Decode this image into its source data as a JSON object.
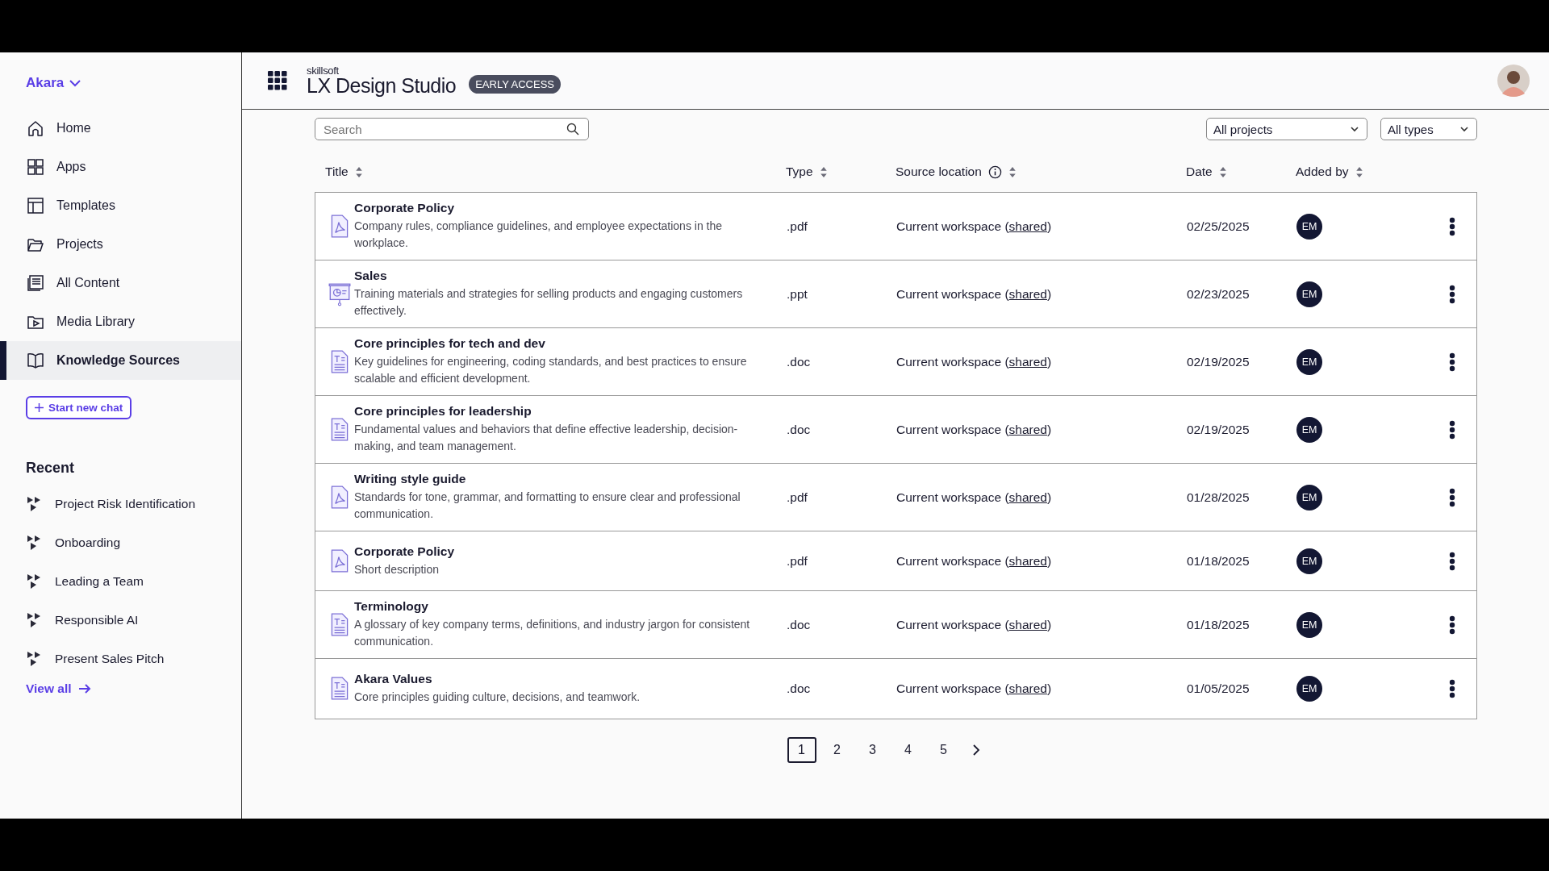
{
  "sidebar": {
    "workspace": "Akara",
    "nav": [
      {
        "label": "Home",
        "selected": false
      },
      {
        "label": "Apps",
        "selected": false
      },
      {
        "label": "Templates",
        "selected": false
      },
      {
        "label": "Projects",
        "selected": false
      },
      {
        "label": "All Content",
        "selected": false
      },
      {
        "label": "Media Library",
        "selected": false
      },
      {
        "label": "Knowledge Sources",
        "selected": true
      }
    ],
    "start_chat": "Start new chat",
    "recent": {
      "title": "Recent",
      "items": [
        "Project Risk Identification",
        "Onboarding",
        "Leading a Team",
        "Responsible AI",
        "Present Sales Pitch"
      ],
      "view_all": "View all"
    }
  },
  "header": {
    "brand": "skillsoft",
    "product": "LX Design Studio",
    "badge": "EARLY ACCESS"
  },
  "filters": {
    "search": {
      "placeholder": "Search"
    },
    "dropdowns": [
      "All projects",
      "All types"
    ]
  },
  "table": {
    "columns": [
      {
        "label": "Title",
        "info": false
      },
      {
        "label": "Type",
        "info": false
      },
      {
        "label": "Source location",
        "info": true
      },
      {
        "label": "Date",
        "info": false
      },
      {
        "label": "Added by",
        "info": false
      }
    ],
    "rows": [
      {
        "kind": "pdf",
        "title": "Corporate Policy",
        "description": "Company rules, compliance guidelines, and employee expectations in the workplace.",
        "type": ".pdf",
        "source": "Current workspace (",
        "source_link": "shared",
        "source_end": ")",
        "date": "02/25/2025",
        "added_by": "EM"
      },
      {
        "kind": "ppt",
        "title": "Sales",
        "description": "Training materials and strategies for selling products and engaging customers effectively.",
        "type": ".ppt",
        "source": "Current workspace (",
        "source_link": "shared",
        "source_end": ")",
        "date": "02/23/2025",
        "added_by": "EM"
      },
      {
        "kind": "doc",
        "title": "Core principles for tech and dev",
        "description": "Key guidelines for engineering, coding standards, and best practices to ensure scalable and efficient development.",
        "type": ".doc",
        "source": "Current workspace (",
        "source_link": "shared",
        "source_end": ")",
        "date": "02/19/2025",
        "added_by": "EM"
      },
      {
        "kind": "doc",
        "title": "Core principles for leadership",
        "description": "Fundamental values and behaviors that define effective leadership, decision-making, and team management.",
        "type": ".doc",
        "source": "Current workspace (",
        "source_link": "shared",
        "source_end": ")",
        "date": "02/19/2025",
        "added_by": "EM"
      },
      {
        "kind": "pdf",
        "title": "Writing style guide",
        "description": "Standards for tone, grammar, and formatting to ensure clear and professional communication.",
        "type": ".pdf",
        "source": "Current workspace (",
        "source_link": "shared",
        "source_end": ")",
        "date": "01/28/2025",
        "added_by": "EM"
      },
      {
        "kind": "pdf",
        "title": "Corporate Policy",
        "description": "Short description",
        "type": ".pdf",
        "source": "Current workspace (",
        "source_link": "shared",
        "source_end": ")",
        "date": "01/18/2025",
        "added_by": "EM"
      },
      {
        "kind": "doc",
        "title": "Terminology",
        "description": "A glossary of key company terms, definitions, and industry jargon for consistent communication.",
        "type": ".doc",
        "source": "Current workspace (",
        "source_link": "shared",
        "source_end": ")",
        "date": "01/18/2025",
        "added_by": "EM"
      },
      {
        "kind": "doc",
        "title": "Akara Values",
        "description": "Core principles guiding culture, decisions, and teamwork.",
        "type": ".doc",
        "source": "Current workspace (",
        "source_link": "shared",
        "source_end": ")",
        "date": "01/05/2025",
        "added_by": "EM"
      }
    ]
  },
  "pagination": {
    "pages": [
      {
        "label": "1",
        "selected": true
      },
      {
        "label": "2",
        "selected": false
      },
      {
        "label": "3",
        "selected": false
      },
      {
        "label": "4",
        "selected": false
      },
      {
        "label": "5",
        "selected": false
      }
    ]
  }
}
